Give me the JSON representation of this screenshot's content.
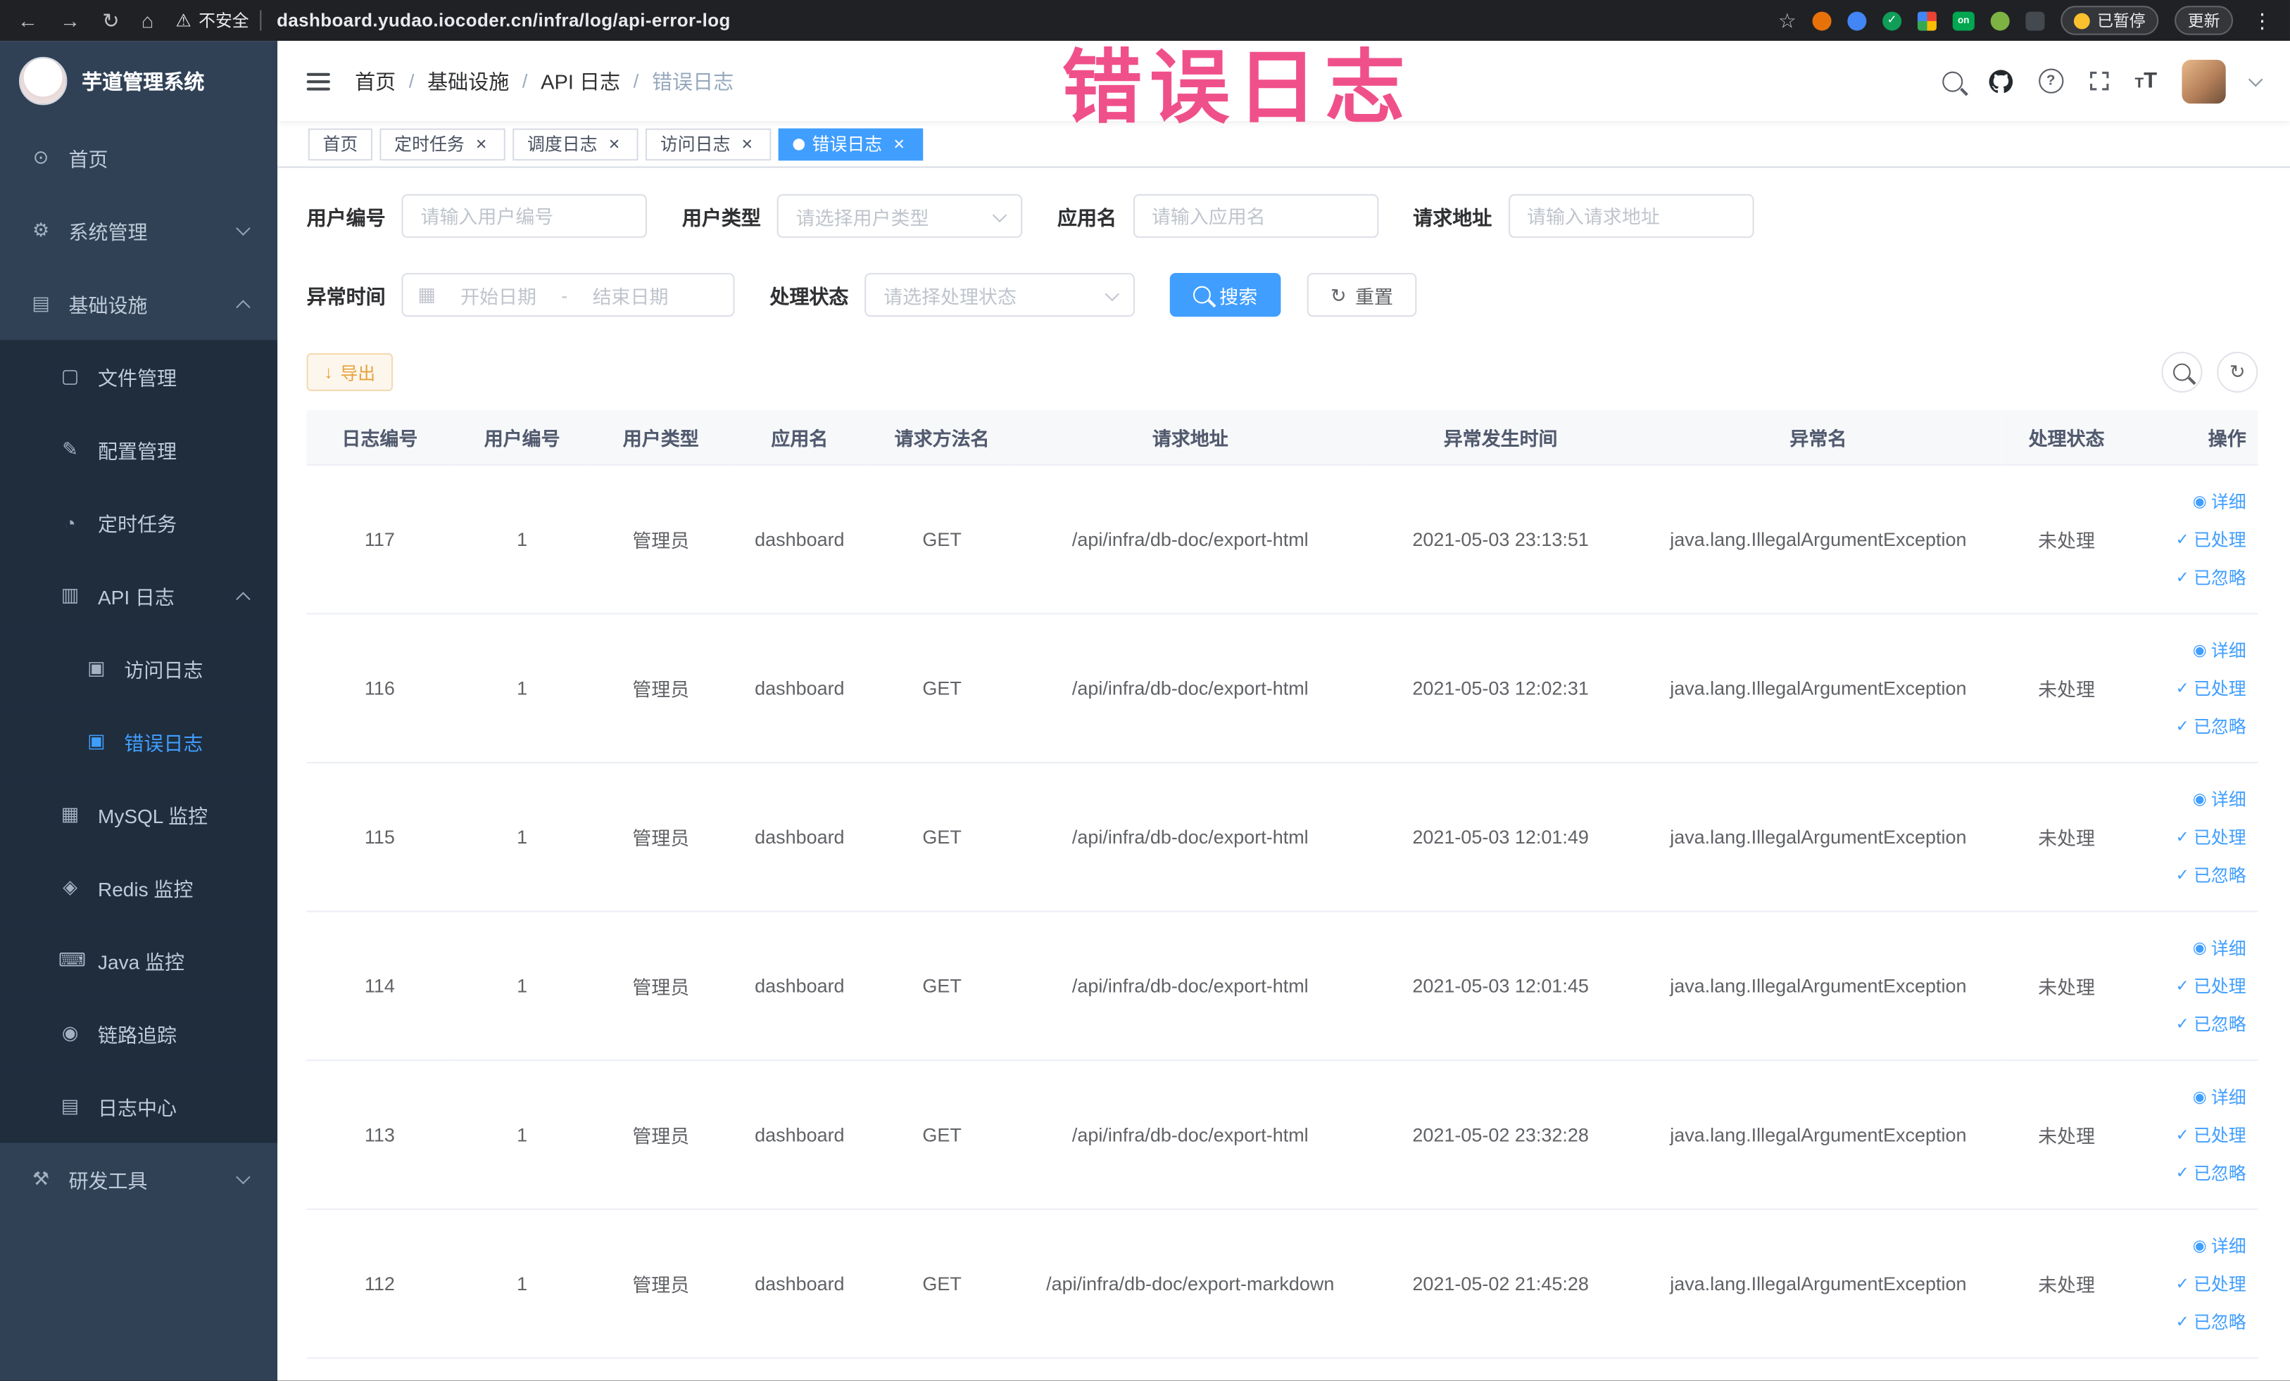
{
  "overlay": {
    "title": "错误日志"
  },
  "browser": {
    "security_label": "不安全",
    "url": "dashboard.yudao.iocoder.cn/infra/log/api-error-log",
    "paused_badge": "已暂停",
    "update_button": "更新"
  },
  "icons": {
    "back": "←",
    "forward": "→",
    "reload": "↻",
    "home": "⌂",
    "warning": "⚠",
    "star": "☆",
    "kebab": "⋮",
    "close": "×",
    "check": "✓",
    "eye": "◉",
    "download": "↓",
    "question": "?",
    "t_small": "T",
    "t_big": "T",
    "calendar": "▦",
    "refresh": "↻",
    "ext_check": "✓",
    "ext_on": "on",
    "menu_dashboard": "⊙",
    "menu_system": "⚙",
    "menu_infra": "▤",
    "menu_file": "▢",
    "menu_config": "✎",
    "menu_task": "◔",
    "menu_api_log": "▥",
    "menu_access_log": "▣",
    "menu_error_log": "▣",
    "menu_mysql": "▦",
    "menu_redis": "◈",
    "menu_java": "⌨",
    "menu_trace": "◉",
    "menu_log_center": "▤",
    "menu_tools": "⚒"
  },
  "sidebar": {
    "logo_title": "芋道管理系统",
    "items": [
      {
        "label": "首页"
      },
      {
        "label": "系统管理"
      },
      {
        "label": "基础设施"
      },
      {
        "label": "文件管理"
      },
      {
        "label": "配置管理"
      },
      {
        "label": "定时任务"
      },
      {
        "label": "API 日志"
      },
      {
        "label": "访问日志"
      },
      {
        "label": "错误日志"
      },
      {
        "label": "MySQL 监控"
      },
      {
        "label": "Redis 监控"
      },
      {
        "label": "Java 监控"
      },
      {
        "label": "链路追踪"
      },
      {
        "label": "日志中心"
      },
      {
        "label": "研发工具"
      }
    ]
  },
  "navbar": {
    "breadcrumb": [
      "首页",
      "基础设施",
      "API 日志",
      "错误日志"
    ],
    "separator": "/"
  },
  "tabs": [
    {
      "label": "首页"
    },
    {
      "label": "定时任务"
    },
    {
      "label": "调度日志"
    },
    {
      "label": "访问日志"
    },
    {
      "label": "错误日志"
    }
  ],
  "filters": {
    "user_id": {
      "label": "用户编号",
      "placeholder": "请输入用户编号"
    },
    "user_type": {
      "label": "用户类型",
      "placeholder": "请选择用户类型"
    },
    "app_name": {
      "label": "应用名",
      "placeholder": "请输入应用名"
    },
    "request_url": {
      "label": "请求地址",
      "placeholder": "请输入请求地址"
    },
    "exception_time": {
      "label": "异常时间",
      "start_placeholder": "开始日期",
      "separator": "-",
      "end_placeholder": "结束日期"
    },
    "process_status": {
      "label": "处理状态",
      "placeholder": "请选择处理状态"
    },
    "search_button": "搜索",
    "reset_button": "重置"
  },
  "toolbar": {
    "export_button": "导出"
  },
  "table": {
    "columns": [
      "日志编号",
      "用户编号",
      "用户类型",
      "应用名",
      "请求方法名",
      "请求地址",
      "异常发生时间",
      "异常名",
      "处理状态",
      "操作"
    ],
    "action_labels": {
      "detail": "详细",
      "processed": "已处理",
      "ignored": "已忽略"
    },
    "rows": [
      {
        "id": "117",
        "user_id": "1",
        "user_type": "管理员",
        "app_name": "dashboard",
        "method": "GET",
        "url": "/api/infra/db-doc/export-html",
        "time": "2021-05-03 23:13:51",
        "exception": "java.lang.IllegalArgumentException",
        "status": "未处理"
      },
      {
        "id": "116",
        "user_id": "1",
        "user_type": "管理员",
        "app_name": "dashboard",
        "method": "GET",
        "url": "/api/infra/db-doc/export-html",
        "time": "2021-05-03 12:02:31",
        "exception": "java.lang.IllegalArgumentException",
        "status": "未处理"
      },
      {
        "id": "115",
        "user_id": "1",
        "user_type": "管理员",
        "app_name": "dashboard",
        "method": "GET",
        "url": "/api/infra/db-doc/export-html",
        "time": "2021-05-03 12:01:49",
        "exception": "java.lang.IllegalArgumentException",
        "status": "未处理"
      },
      {
        "id": "114",
        "user_id": "1",
        "user_type": "管理员",
        "app_name": "dashboard",
        "method": "GET",
        "url": "/api/infra/db-doc/export-html",
        "time": "2021-05-03 12:01:45",
        "exception": "java.lang.IllegalArgumentException",
        "status": "未处理"
      },
      {
        "id": "113",
        "user_id": "1",
        "user_type": "管理员",
        "app_name": "dashboard",
        "method": "GET",
        "url": "/api/infra/db-doc/export-html",
        "time": "2021-05-02 23:32:28",
        "exception": "java.lang.IllegalArgumentException",
        "status": "未处理"
      },
      {
        "id": "112",
        "user_id": "1",
        "user_type": "管理员",
        "app_name": "dashboard",
        "method": "GET",
        "url": "/api/infra/db-doc/export-markdown",
        "time": "2021-05-02 21:45:28",
        "exception": "java.lang.IllegalArgumentException",
        "status": "未处理"
      }
    ]
  }
}
